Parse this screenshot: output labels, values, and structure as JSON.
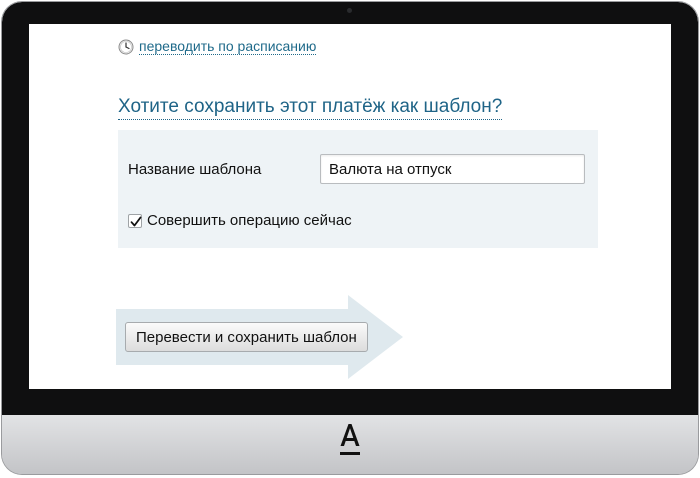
{
  "schedule": {
    "icon": "clock-icon",
    "link_label": "переводить по расписанию"
  },
  "template_form": {
    "question": "Хотите сохранить этот платёж как шаблон?",
    "name_label": "Название шаблона",
    "name_value": "Валюта на отпуск",
    "execute_now_label": "Совершить операцию сейчас",
    "execute_now_checked": true
  },
  "actions": {
    "submit_label": "Перевести и сохранить шаблон"
  },
  "device": {
    "logo": "А"
  },
  "colors": {
    "link": "#1f6a8a",
    "panel_bg": "#eef3f6",
    "arrow": "#dfe9ee"
  }
}
